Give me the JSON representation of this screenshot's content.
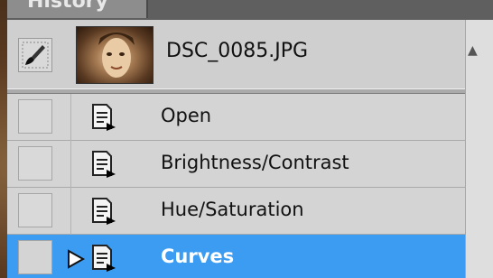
{
  "panel": {
    "tab_label": "History"
  },
  "snapshot": {
    "filename": "DSC_0085.JPG",
    "icon": "snapshot-brush-icon"
  },
  "steps": [
    {
      "label": "Open",
      "icon": "history-step-icon",
      "active": false
    },
    {
      "label": "Brightness/Contrast",
      "icon": "history-step-icon",
      "active": false
    },
    {
      "label": "Hue/Saturation",
      "icon": "history-step-icon",
      "active": false
    },
    {
      "label": "Curves",
      "icon": "history-step-icon",
      "active": true
    }
  ],
  "colors": {
    "active_row": "#3b9cf2",
    "panel_bg": "#d4d4d4"
  }
}
